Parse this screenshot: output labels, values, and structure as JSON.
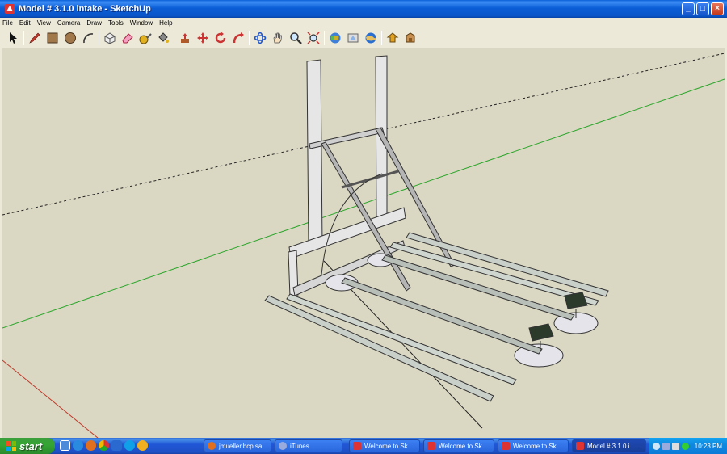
{
  "window": {
    "title": "Model # 3.1.0 intake - SketchUp",
    "minimize_glyph": "_",
    "maximize_glyph": "□",
    "close_glyph": "×"
  },
  "menu": [
    "File",
    "Edit",
    "View",
    "Camera",
    "Draw",
    "Tools",
    "Window",
    "Help"
  ],
  "toolbar": {
    "groups": [
      [
        "select-icon",
        "pencil-icon",
        "rectangle-icon",
        "circle-icon",
        "arc-icon"
      ],
      [
        "make-component-icon",
        "eraser-icon",
        "tape-measure-icon",
        "paint-bucket-icon"
      ],
      [
        "push-pull-icon",
        "move-icon",
        "rotate-icon",
        "follow-me-icon"
      ],
      [
        "orbit-icon",
        "pan-icon",
        "zoom-icon",
        "zoom-extents-icon"
      ],
      [
        "get-models-icon",
        "share-model-icon",
        "google-earth-icon"
      ],
      [
        "get-models-toolbar-icon",
        "photo-textures-icon"
      ]
    ]
  },
  "colors": {
    "viewport_bg": "#dad7c2",
    "green_axis": "#2aa62a",
    "red_axis": "#c0392b",
    "xp_blue": "#245edb",
    "start_green": "#35a635"
  },
  "taskbar": {
    "start_label": "start",
    "quick_launch": [
      "show-desktop-icon",
      "ie-icon",
      "firefox-icon",
      "chrome-icon",
      "outlook-icon",
      "skype-icon",
      "messenger-icon"
    ],
    "tasks": [
      {
        "label": "jmueller.bcp.sa...",
        "active": false
      },
      {
        "label": "iTunes",
        "active": false
      },
      {
        "label": "Welcome to Sk...",
        "active": false
      },
      {
        "label": "Welcome to Sk...",
        "active": false
      },
      {
        "label": "Welcome to Sk...",
        "active": false
      },
      {
        "label": "Model # 3.1.0 i...",
        "active": true
      }
    ],
    "clock": "10:23 PM"
  }
}
